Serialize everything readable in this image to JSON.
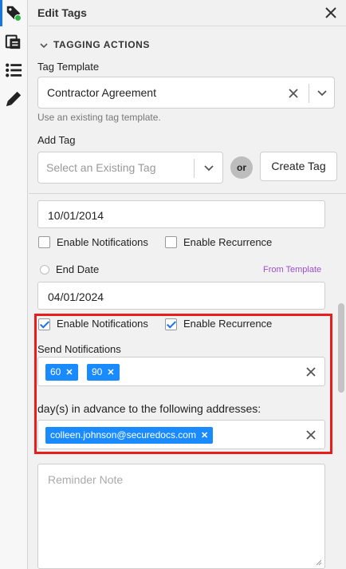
{
  "header": {
    "title": "Edit Tags"
  },
  "section": {
    "title": "TAGGING ACTIONS"
  },
  "tag_template": {
    "label": "Tag Template",
    "value": "Contractor Agreement",
    "hint": "Use an existing tag template."
  },
  "add_tag": {
    "label": "Add Tag",
    "placeholder": "Select an Existing Tag",
    "or_label": "or",
    "create_button": "Create Tag"
  },
  "start_date": {
    "value": "10/01/2014"
  },
  "first_options": {
    "notifications_label": "Enable Notifications",
    "notifications_checked": false,
    "recurrence_label": "Enable Recurrence",
    "recurrence_checked": false
  },
  "end_date": {
    "label": "End Date",
    "from_template": "From Template",
    "value": "04/01/2024"
  },
  "second_options": {
    "notifications_label": "Enable Notifications",
    "notifications_checked": true,
    "recurrence_label": "Enable Recurrence",
    "recurrence_checked": true
  },
  "notifications": {
    "label": "Send Notifications",
    "days": [
      "60",
      "90"
    ],
    "advance_label": "day(s) in advance to the following addresses:",
    "addresses": [
      "colleen.johnson@securedocs.com"
    ]
  },
  "reminder": {
    "placeholder": "Reminder Note"
  },
  "colors": {
    "accent": "#1a8bff",
    "highlight": "#ea1c1c",
    "template_link": "#9c4fd1",
    "status_dot": "#2fb344"
  },
  "rail_icons": [
    "tag-icon",
    "document-stack-icon",
    "list-icon",
    "pen-icon"
  ]
}
